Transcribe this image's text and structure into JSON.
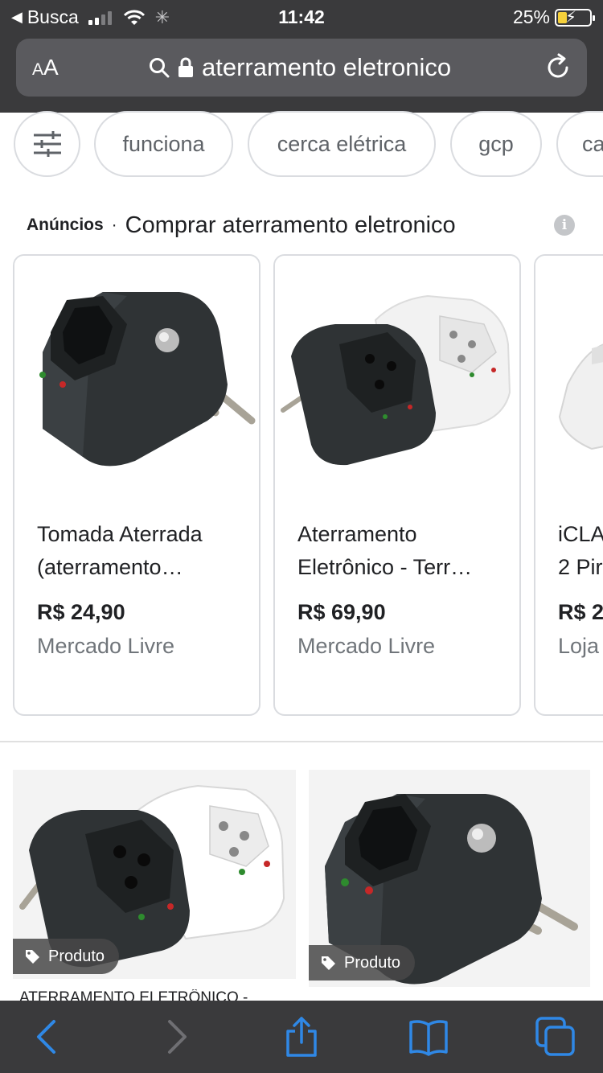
{
  "status_bar": {
    "carrier": "Busca",
    "time": "11:42",
    "battery": "25%",
    "battery_level": 0.25
  },
  "browser": {
    "text_size_label_small": "A",
    "text_size_label_large": "A",
    "url_text": "aterramento eletronico",
    "icons": [
      "search-icon",
      "lock-icon",
      "reload-icon"
    ]
  },
  "chips": [
    "funciona",
    "cerca elétrica",
    "gcp",
    "ca"
  ],
  "ads": {
    "label": "Anúncios",
    "separator": "·",
    "title": "Comprar aterramento eletronico",
    "info_icon": "i"
  },
  "products": [
    {
      "title_line1": "Tomada Aterrada",
      "title_line2": "(aterramento…",
      "price": "R$ 24,90",
      "store": "Mercado Livre"
    },
    {
      "title_line1": "Aterramento",
      "title_line2": "Eletrônico - Terr…",
      "price": "R$ 69,90",
      "store": "Mercado Livre"
    },
    {
      "title_line1": "iCLA",
      "title_line2": "2 Pir",
      "price": "R$ 2",
      "store": "Loja"
    }
  ],
  "tiles": [
    {
      "badge": "Produto",
      "caption": "ATERRAMENTO ELETRÔNICO -"
    },
    {
      "badge": "Produto"
    }
  ],
  "colors": {
    "chrome_bg": "#3a3a3c",
    "url_bar_bg": "#5a5a5e",
    "toolbar_accent": "#2f88e6",
    "toolbar_disabled": "#6f6f73",
    "battery_fill": "#f6d13b"
  },
  "toolbar": {
    "icons": [
      "back-icon",
      "forward-icon",
      "share-icon",
      "bookmarks-icon",
      "tabs-icon"
    ]
  }
}
